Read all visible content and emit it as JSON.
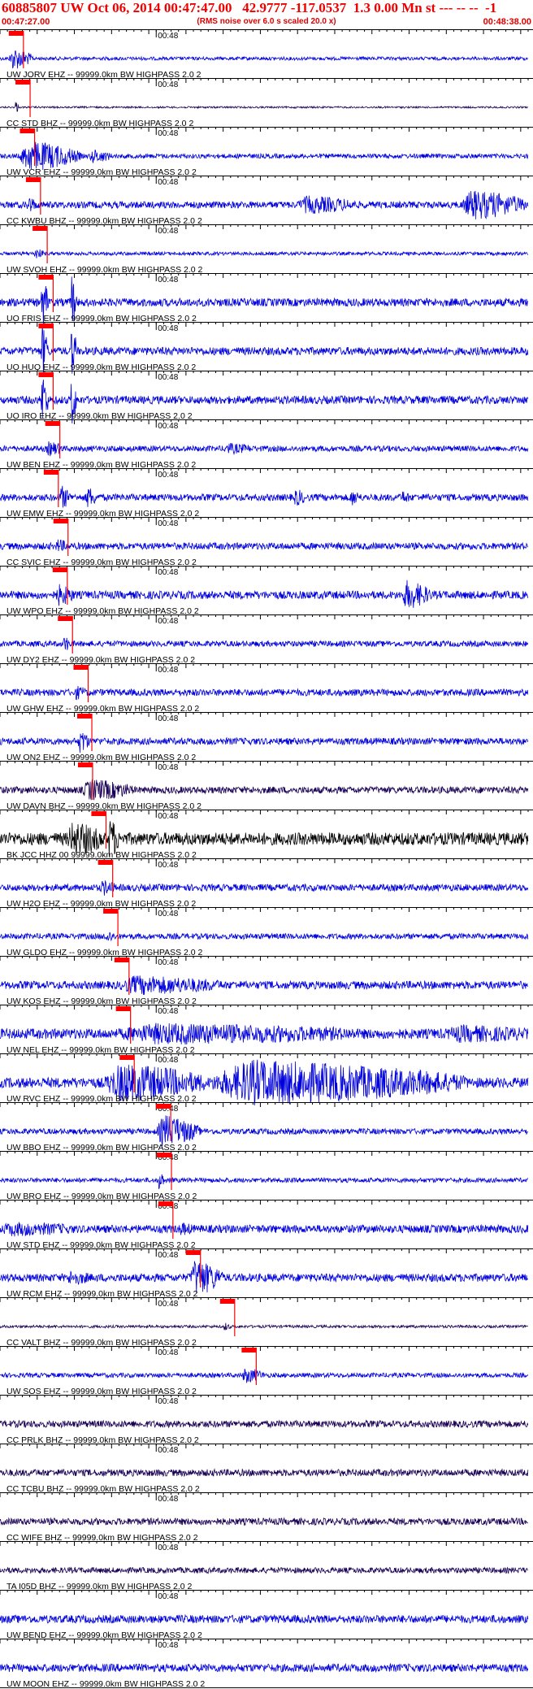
{
  "header": {
    "title": "60885807 UW Oct 06, 2014 00:47:47.00   42.9777 -117.0537  1.3 0.00 Mn st --- -- --  -1",
    "start_time": "00:47:27.00",
    "note": "(RMS noise over 6.0 s scaled 20.0 x)",
    "end_time": "00:48:38.00"
  },
  "colors": {
    "trace_blue": "#0000dd",
    "trace_dark": "#1a0055",
    "trace_black": "#000000",
    "pick_red": "#ff0000",
    "label_text": "#000000",
    "header_red": "#ee0000"
  },
  "chart_data": {
    "type": "line",
    "x_start": "00:47:27.00",
    "x_end": "00:48:38.00",
    "time_tick_label": "00:48",
    "tick_label_right": "0",
    "filter_text": "99999.0km BW  HIGHPASS  2.0  2",
    "channels": [
      {
        "label": "UW JORV EHZ -- 99999.0km BW  HIGHPASS  2.0  2",
        "color": "blue",
        "pick": 1.4,
        "spans": [
          [
            1.2,
            4.5,
            1.0
          ]
        ],
        "noise": 0.15
      },
      {
        "label": "CC STD BHZ -- 99999.0km BW  HIGHPASS  2.0  2",
        "color": "dark",
        "pick": 2.3,
        "spans": [
          [
            2.0,
            2.5,
            0.7
          ]
        ],
        "noise": 0.08
      },
      {
        "label": "UW VCR EHZ -- 99999.0km BW  HIGHPASS  2.0  2",
        "color": "blue",
        "pick": 2.9,
        "spans": [
          [
            2.5,
            11.0,
            1.4
          ],
          [
            12.0,
            15.0,
            0.5
          ]
        ],
        "noise": 0.2
      },
      {
        "label": "CC KWBU BHZ -- 99999.0km BW  HIGHPASS  2.0  2",
        "color": "blue",
        "pick": 3.7,
        "spans": [
          [
            3.5,
            5.0,
            0.5
          ],
          [
            40.0,
            48.0,
            0.6
          ],
          [
            62.0,
            71.0,
            1.2
          ]
        ],
        "noise": 0.3
      },
      {
        "label": "UW SVOH EHZ -- 99999.0km BW  HIGHPASS  2.0  2",
        "color": "blue",
        "pick": 4.6,
        "spans": [
          [
            4.5,
            6.0,
            0.4
          ]
        ],
        "noise": 0.15
      },
      {
        "label": "UO FRIS EHZ -- 99999.0km BW  HIGHPASS  2.0  2",
        "color": "blue",
        "pick": 5.4,
        "spans": [
          [
            5.5,
            6.5,
            2.5
          ],
          [
            9.5,
            10.3,
            2.5
          ]
        ],
        "noise": 0.35
      },
      {
        "label": "UO HUQ EHZ -- 99999.0km BW  HIGHPASS  2.0  2",
        "color": "blue",
        "pick": 5.4,
        "spans": [
          [
            5.5,
            6.5,
            2.5
          ],
          [
            9.5,
            10.3,
            2.5
          ]
        ],
        "noise": 0.35
      },
      {
        "label": "UO IRO EHZ -- 99999.0km BW  HIGHPASS  2.0  2",
        "color": "blue",
        "pick": 5.4,
        "spans": [
          [
            5.5,
            6.5,
            2.5
          ],
          [
            9.5,
            10.3,
            2.5
          ]
        ],
        "noise": 0.35
      },
      {
        "label": "UW BEN EHZ -- 99999.0km BW  HIGHPASS  2.0  2",
        "color": "blue",
        "pick": 6.3,
        "spans": [
          [
            6.2,
            8.5,
            0.5
          ],
          [
            30.0,
            34.0,
            0.3
          ]
        ],
        "noise": 0.25
      },
      {
        "label": "UW EMW EHZ -- 99999.0km BW  HIGHPASS  2.0  2",
        "color": "blue",
        "pick": 6.1,
        "spans": [
          [
            8.0,
            9.5,
            0.9
          ],
          [
            11.5,
            13.0,
            0.8
          ],
          [
            39.5,
            41.0,
            0.6
          ],
          [
            47.0,
            48.5,
            0.5
          ],
          [
            54.0,
            55.0,
            0.4
          ]
        ],
        "noise": 0.3
      },
      {
        "label": "CC SVIC EHZ -- 99999.0km BW  HIGHPASS  2.0  2",
        "color": "blue",
        "pick": 7.4,
        "spans": [
          [
            7.5,
            9.0,
            0.4
          ]
        ],
        "noise": 0.3
      },
      {
        "label": "UW WPO EHZ -- 99999.0km BW  HIGHPASS  2.0  2",
        "color": "blue",
        "pick": 7.3,
        "spans": [
          [
            7.5,
            10.0,
            0.7
          ],
          [
            54.0,
            58.0,
            1.1
          ]
        ],
        "noise": 0.35
      },
      {
        "label": "UW DY2 EHZ -- 99999.0km BW  HIGHPASS  2.0  2",
        "color": "blue",
        "pick": 8.0,
        "spans": [
          [
            8.5,
            9.5,
            0.6
          ]
        ],
        "noise": 0.25
      },
      {
        "label": "UW GHW EHZ -- 99999.0km BW  HIGHPASS  2.0  2",
        "color": "blue",
        "pick": 10.1,
        "spans": [
          [
            10.0,
            11.5,
            0.4
          ]
        ],
        "noise": 0.3
      },
      {
        "label": "UW ON2 EHZ -- 99999.0km BW  HIGHPASS  2.0  2",
        "color": "blue",
        "pick": 10.6,
        "spans": [
          [
            10.5,
            12.0,
            0.9
          ]
        ],
        "noise": 0.3
      },
      {
        "label": "UW DAVN BHZ -- 99999.0km BW  HIGHPASS  2.0  2",
        "color": "dark",
        "pick": 10.7,
        "spans": [
          [
            11.0,
            18.0,
            0.8
          ]
        ],
        "noise": 0.3
      },
      {
        "label": "BK JCC HHZ 00 99999.0km BW  HIGHPASS  2.0  2",
        "color": "black",
        "pick": 12.5,
        "spans": [
          [
            9.0,
            14.0,
            1.2
          ],
          [
            14.5,
            16.0,
            1.6
          ]
        ],
        "noise": 0.55
      },
      {
        "label": "UW H2O EHZ -- 99999.0km BW  HIGHPASS  2.0  2",
        "color": "blue",
        "pick": 13.4,
        "spans": [
          [
            13.5,
            15.5,
            0.5
          ]
        ],
        "noise": 0.3
      },
      {
        "label": "UW GLDO EHZ -- 99999.0km BW  HIGHPASS  2.0  2",
        "color": "blue",
        "pick": 14.1,
        "spans": [
          [
            14.0,
            15.5,
            0.4
          ]
        ],
        "noise": 0.25
      },
      {
        "label": "UW KOS EHZ -- 99999.0km BW  HIGHPASS  2.0  2",
        "color": "blue",
        "pick": 15.6,
        "spans": [
          [
            16.0,
            30.0,
            0.6
          ]
        ],
        "noise": 0.35
      },
      {
        "label": "UW NEL EHZ -- 99999.0km BW  HIGHPASS  2.0  2",
        "color": "blue",
        "pick": 15.8,
        "spans": [
          [
            16.0,
            48.0,
            0.6
          ],
          [
            60.0,
            71.0,
            0.4
          ]
        ],
        "noise": 0.45
      },
      {
        "label": "UW RVC EHZ -- 99999.0km BW  HIGHPASS  2.0  2",
        "color": "blue",
        "pick": 16.3,
        "spans": [
          [
            14.0,
            28.0,
            1.5
          ],
          [
            28.0,
            63.0,
            1.8
          ]
        ],
        "noise": 0.45
      },
      {
        "label": "UW BBO EHZ -- 99999.0km BW  HIGHPASS  2.0  2",
        "color": "blue",
        "pick": 21.2,
        "spans": [
          [
            21.0,
            27.0,
            1.4
          ]
        ],
        "noise": 0.25
      },
      {
        "label": "UW BRO EHZ -- 99999.0km BW  HIGHPASS  2.0  2",
        "color": "blue",
        "pick": 21.3,
        "spans": [
          [
            21.3,
            22.0,
            1.2
          ]
        ],
        "noise": 0.2
      },
      {
        "label": "UW STD EHZ -- 99999.0km BW  HIGHPASS  2.0  2",
        "color": "blue",
        "pick": 21.5,
        "spans": [
          [
            0.0,
            10.0,
            0.35
          ],
          [
            24.0,
            26.0,
            0.3
          ]
        ],
        "noise": 0.35
      },
      {
        "label": "UW RCM EHZ -- 99999.0km BW  HIGHPASS  2.0  2",
        "color": "blue",
        "pick": 25.2,
        "spans": [
          [
            9.0,
            12.0,
            0.4
          ],
          [
            25.5,
            30.0,
            1.5
          ]
        ],
        "noise": 0.35
      },
      {
        "label": "CC VALT BHZ -- 99999.0km BW  HIGHPASS  2.0  2",
        "color": "dark",
        "pick": 29.8,
        "spans": [
          [
            30.0,
            31.0,
            0.3
          ]
        ],
        "noise": 0.12
      },
      {
        "label": "UW SOS EHZ -- 99999.0km BW  HIGHPASS  2.0  2",
        "color": "blue",
        "pick": 32.7,
        "spans": [
          [
            32.5,
            35.5,
            0.6
          ]
        ],
        "noise": 0.2
      },
      {
        "label": "CC PRLK BHZ -- 99999.0km BW  HIGHPASS  2.0  2",
        "color": "dark",
        "pick": null,
        "spans": [],
        "noise": 0.3
      },
      {
        "label": "CC TCBU BHZ -- 99999.0km BW  HIGHPASS  2.0  2",
        "color": "dark",
        "pick": null,
        "spans": [],
        "noise": 0.3
      },
      {
        "label": "CC WIFE BHZ -- 99999.0km BW  HIGHPASS  2.0  2",
        "color": "dark",
        "pick": null,
        "spans": [],
        "noise": 0.3
      },
      {
        "label": "TA I05D BHZ -- 99999.0km BW  HIGHPASS  2.0  2",
        "color": "dark",
        "pick": null,
        "spans": [],
        "noise": 0.25
      },
      {
        "label": "UW BEND EHZ -- 99999.0km BW  HIGHPASS  2.0  2",
        "color": "blue",
        "pick": null,
        "spans": [],
        "noise": 0.35
      },
      {
        "label": "UW MOON EHZ -- 99999.0km BW  HIGHPASS  2.0  2",
        "color": "blue",
        "pick": null,
        "spans": [],
        "noise": 0.35
      }
    ]
  }
}
